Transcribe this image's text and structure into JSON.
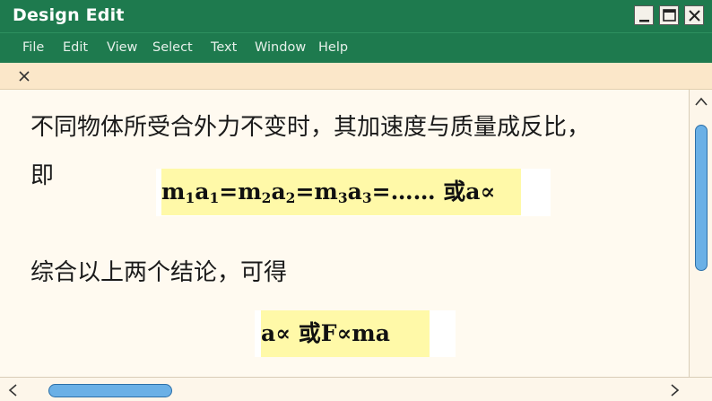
{
  "window": {
    "title": "Design Edit"
  },
  "menu": [
    "File",
    "Edit",
    "View",
    "Select",
    "Text",
    "Window",
    "Help"
  ],
  "content": {
    "line1": "不同物体所受合外力不变时，其加速度与质量成反比，",
    "line2": "即",
    "formula1": {
      "m1": "m",
      "s1": "1",
      "a1": "a",
      "t1": "1",
      "eq1": "=",
      "m2": "m",
      "s2": "2",
      "a2": "a",
      "t2": "2",
      "eq2": "=",
      "m3": "m",
      "s3": "3",
      "a3": "a",
      "t3": "3",
      "tail": "=……  或a∝"
    },
    "line3": "综合以上两个结论，可得",
    "formula2": "a∝  或F∝ma"
  },
  "colors": {
    "titlebar": "#1e7a4e",
    "tabbar": "#fbe7c9",
    "highlight": "#fff9a8",
    "scroll_thumb": "#6ab0e6"
  },
  "scroll": {
    "vertical_position": 0.1,
    "horizontal_position": 0.05
  }
}
